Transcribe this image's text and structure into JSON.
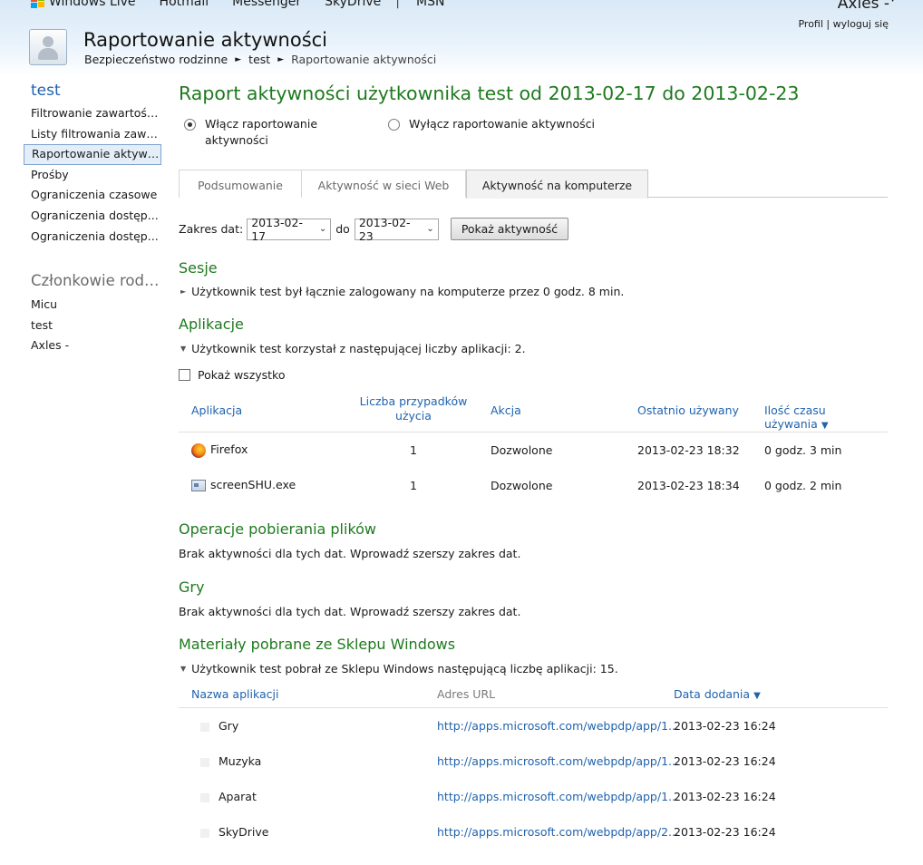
{
  "header": {
    "brand": "Windows Live",
    "nav": [
      "Hotmail",
      "Messenger",
      "SkyDrive",
      "MSN"
    ],
    "separator": "|",
    "user_name": "Axles -",
    "profile_link": "Profil",
    "link_sep": "|",
    "logout_link": "wyloguj się",
    "page_title": "Raportowanie aktywności",
    "breadcrumb": [
      "Bezpieczeństwo rodzinne",
      "test",
      "Raportowanie aktywności"
    ],
    "breadcrumb_arrow": "►"
  },
  "sidebar": {
    "user_heading": "test",
    "items": [
      {
        "label": "Filtrowanie zawartości..."
      },
      {
        "label": "Listy filtrowania zawar..."
      },
      {
        "label": "Raportowanie aktywn..."
      },
      {
        "label": "Prośby"
      },
      {
        "label": "Ograniczenia czasowe"
      },
      {
        "label": "Ograniczenia dostęp..."
      },
      {
        "label": "Ograniczenia dostęp..."
      }
    ],
    "members_heading": "Członkowie rodz...",
    "members": [
      "Micu",
      "test",
      "Axles -"
    ]
  },
  "main": {
    "report_title": "Raport aktywności użytkownika test od 2013-02-17 do 2013-02-23",
    "radio_on": "Włącz raportowanie aktywności",
    "radio_off": "Wyłącz raportowanie aktywności",
    "tabs": [
      "Podsumowanie",
      "Aktywność w sieci Web",
      "Aktywność na komputerze"
    ],
    "date_label": "Zakres dat:",
    "date_from": "2013-02-17",
    "date_to_label": "do",
    "date_to": "2013-02-23",
    "show_button": "Pokaż aktywność",
    "sessions": {
      "heading": "Sesje",
      "text": "Użytkownik test był łącznie zalogowany na komputerze przez 0 godz. 8 min."
    },
    "apps": {
      "heading": "Aplikacje",
      "text": "Użytkownik test korzystał z następującej liczby aplikacji: 2.",
      "show_all": "Pokaż wszystko",
      "columns": {
        "app": "Aplikacja",
        "count": "Liczba przypadków użycia",
        "action": "Akcja",
        "last_used": "Ostatnio używany",
        "time": "Ilość czasu używania"
      },
      "rows": [
        {
          "name": "Firefox",
          "count": "1",
          "action": "Dozwolone",
          "last": "2013-02-23 18:32",
          "time": "0 godz. 3 min"
        },
        {
          "name": "screenSHU.exe",
          "count": "1",
          "action": "Dozwolone",
          "last": "2013-02-23 18:34",
          "time": "0 godz. 2 min"
        }
      ]
    },
    "downloads": {
      "heading": "Operacje pobierania plików",
      "text": "Brak aktywności dla tych dat. Wprowadź szerszy zakres dat."
    },
    "games": {
      "heading": "Gry",
      "text": "Brak aktywności dla tych dat. Wprowadź szerszy zakres dat."
    },
    "store": {
      "heading": "Materiały pobrane ze Sklepu Windows",
      "text": "Użytkownik test pobrał ze Sklepu Windows następującą liczbę aplikacji: 15.",
      "columns": {
        "name": "Nazwa aplikacji",
        "url": "Adres URL",
        "date": "Data dodania"
      },
      "rows": [
        {
          "name": "Gry",
          "url": "http://apps.microsoft.com/webpdp/app/1...",
          "date": "2013-02-23 16:24"
        },
        {
          "name": "Muzyka",
          "url": "http://apps.microsoft.com/webpdp/app/1...",
          "date": "2013-02-23 16:24"
        },
        {
          "name": "Aparat",
          "url": "http://apps.microsoft.com/webpdp/app/1...",
          "date": "2013-02-23 16:24"
        },
        {
          "name": "SkyDrive",
          "url": "http://apps.microsoft.com/webpdp/app/2...",
          "date": "2013-02-23 16:24"
        }
      ]
    }
  }
}
